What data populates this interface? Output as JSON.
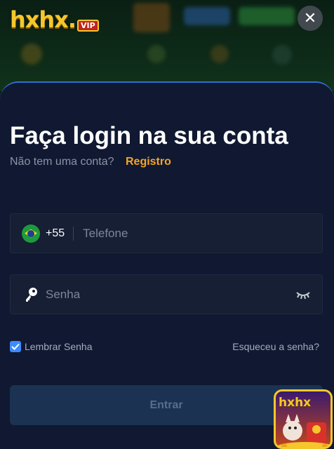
{
  "brand": {
    "logo_text": "hxhx.",
    "logo_badge": "VIP",
    "promo_text": "hxhx"
  },
  "colors": {
    "panel_bg": "#101931",
    "accent_link": "#f5a623",
    "checkbox": "#3d8bfd",
    "panel_border": "#2f6fd0"
  },
  "close": {
    "icon": "close-icon",
    "glyph": "✕"
  },
  "login": {
    "title": "Faça login na sua conta",
    "no_account_text": "Não tem uma conta?",
    "register_link": "Registro",
    "phone": {
      "country_code": "+55",
      "flag_icon": "brazil-flag-icon",
      "placeholder": "Telefone",
      "value": ""
    },
    "password": {
      "placeholder": "Senha",
      "value": "",
      "leading_icon": "key-icon",
      "toggle_icon": "eye-closed-icon"
    },
    "remember": {
      "label": "Lembrar Senha",
      "checked": true
    },
    "forgot_link": "Esqueceu a senha?",
    "submit_label": "Entrar"
  }
}
